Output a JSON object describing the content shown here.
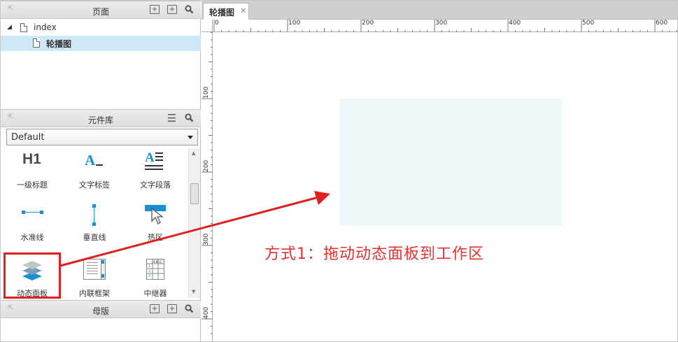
{
  "pages_panel": {
    "title": "页面",
    "tree": [
      {
        "label": "index",
        "expanded": true
      },
      {
        "label": "轮播图",
        "selected": true
      }
    ]
  },
  "library_panel": {
    "title": "元件库",
    "selected_library": "Default",
    "widgets": [
      {
        "label": "一级标题",
        "icon": "heading1-icon"
      },
      {
        "label": "文字标签",
        "icon": "text-label-icon"
      },
      {
        "label": "文字段落",
        "icon": "text-paragraph-icon"
      },
      {
        "label": "水准线",
        "icon": "horizontal-line-icon"
      },
      {
        "label": "垂直线",
        "icon": "vertical-line-icon"
      },
      {
        "label": "热区",
        "icon": "hotspot-icon"
      },
      {
        "label": "动态面板",
        "icon": "dynamic-panel-icon"
      },
      {
        "label": "内联框架",
        "icon": "inline-frame-icon"
      },
      {
        "label": "中继器",
        "icon": "repeater-icon"
      }
    ]
  },
  "masters_panel": {
    "title": "母版"
  },
  "editor": {
    "tab_label": "轮播图",
    "close_glyph": "✕",
    "h_ruler_labels": [
      "0",
      "100",
      "200",
      "300",
      "400",
      "500",
      "600"
    ],
    "v_ruler_labels": [
      "100",
      "200",
      "300",
      "400"
    ]
  },
  "annotation": {
    "text": "方式1：拖动动态面板到工作区",
    "color": "#e5312f"
  },
  "colors": {
    "selection": "#cde8f6",
    "icon_blue": "#1a8fd6",
    "highlight_red": "#e02020",
    "dynamic_panel_fill": "#edf6f9"
  }
}
